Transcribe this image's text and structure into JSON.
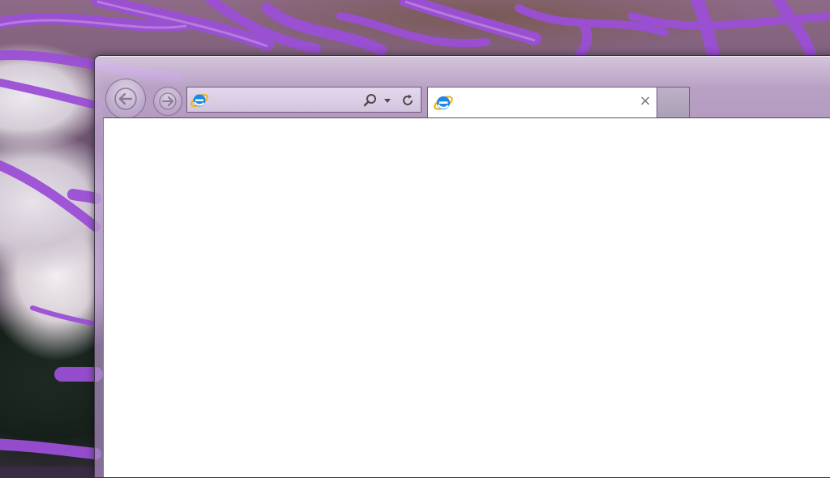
{
  "browser": {
    "address_bar": {
      "value": "",
      "placeholder": "",
      "page_icon": "ie-logo-icon",
      "buttons": [
        "search-icon",
        "chevron-down-icon",
        "refresh-icon"
      ]
    },
    "nav": {
      "back_icon": "back-arrow-icon",
      "forward_icon": "forward-arrow-icon"
    },
    "tab": {
      "title": "",
      "icon": "ie-logo-icon",
      "close_glyph": "×"
    },
    "colors": {
      "frame_tint": "#c8b4dc",
      "frame_border": "#3b2f46",
      "ie_blue": "#1e88e5",
      "ie_gold": "#f3b415"
    }
  }
}
